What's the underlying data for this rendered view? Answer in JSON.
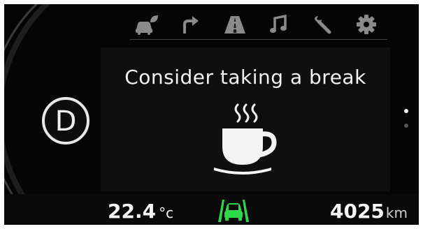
{
  "menu": {
    "icons": [
      "eco-car-icon",
      "turn-arrow-icon",
      "road-icon",
      "music-note-icon",
      "wrench-icon",
      "gear-settings-icon"
    ]
  },
  "gear": {
    "label": "D"
  },
  "message": {
    "title": "Consider taking a break",
    "icon": "coffee-cup-icon"
  },
  "pagination": {
    "total": 2,
    "active": 1
  },
  "status": {
    "temperature_value": "22.4",
    "temperature_unit": "°c",
    "odometer_value": "4025",
    "odometer_unit": "km",
    "lane_assist_icon": "lane-assist-icon"
  },
  "colors": {
    "accent_green": "#2fd84a",
    "text": "#f3f3f3",
    "background": "#050505"
  }
}
